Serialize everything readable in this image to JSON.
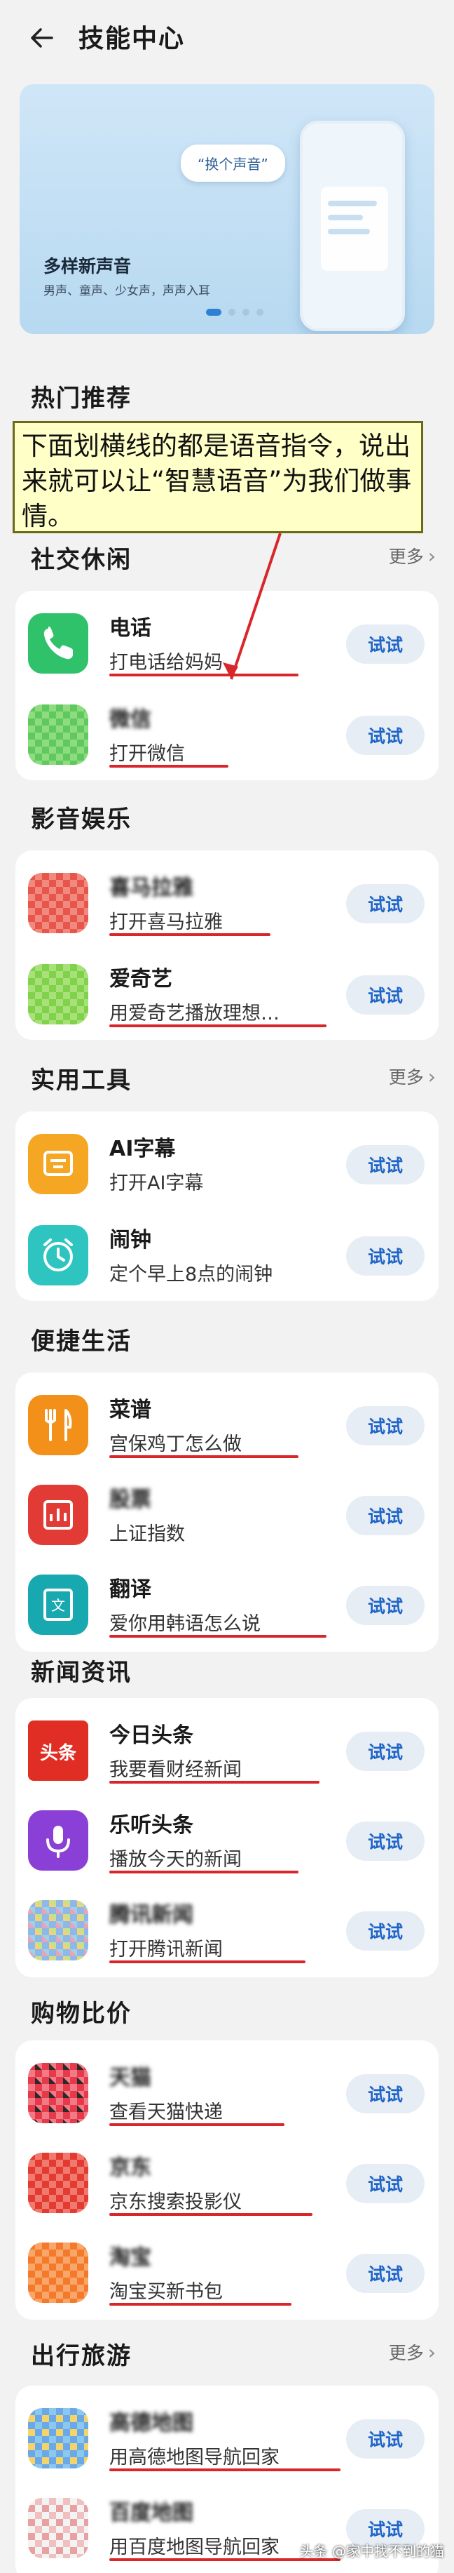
{
  "header": {
    "title": "技能中心"
  },
  "banner": {
    "title": "多样新声音",
    "subtitle": "男声、童声、少女声，声声入耳",
    "bubble": "“换个声音”"
  },
  "sections": {
    "hot": {
      "title": "热门推荐"
    },
    "social": {
      "title": "社交休闲",
      "more": "更多"
    },
    "media": {
      "title": "影音娱乐"
    },
    "tools": {
      "title": "实用工具",
      "more": "更多"
    },
    "life": {
      "title": "便捷生活"
    },
    "news": {
      "title": "新闻资讯"
    },
    "shopping": {
      "title": "购物比价"
    },
    "travel": {
      "title": "出行旅游",
      "more": "更多"
    }
  },
  "annotation": "下面划横线的都是语音指令，说出来就可以让“智慧语音”为我们做事情。",
  "rows": {
    "phone": {
      "title": "电话",
      "cmd": "打电话给妈妈",
      "try": "试试"
    },
    "social2": {
      "title": "微信",
      "cmd": "打开微信",
      "try": "试试"
    },
    "music": {
      "title": "喜马拉雅",
      "cmd": "打开喜马拉雅",
      "try": "试试"
    },
    "iqiyi": {
      "title": "爱奇艺",
      "cmd": "用爱奇艺播放理想…",
      "try": "试试"
    },
    "subtitle": {
      "title": "AI字幕",
      "cmd": "打开AI字幕",
      "try": "试试"
    },
    "alarm": {
      "title": "闹钟",
      "cmd": "定个早上8点的闹钟",
      "try": "试试"
    },
    "recipe": {
      "title": "菜谱",
      "cmd": "宫保鸡丁怎么做",
      "try": "试试"
    },
    "stock": {
      "title": "股票",
      "cmd": "上证指数",
      "try": "试试"
    },
    "translate": {
      "title": "翻译",
      "cmd": "爱你用韩语怎么说",
      "try": "试试"
    },
    "toutiao": {
      "title": "今日头条",
      "cmd": "我要看财经新闻",
      "try": "试试"
    },
    "listen": {
      "title": "乐听头条",
      "cmd": "播放今天的新闻",
      "try": "试试"
    },
    "tencent": {
      "title": "腾讯新闻",
      "cmd": "打开腾讯新闻",
      "try": "试试"
    },
    "tmall": {
      "title": "天猫",
      "cmd": "查看天猫快递",
      "try": "试试"
    },
    "jd": {
      "title": "京东",
      "cmd": "京东搜索投影仪",
      "try": "试试"
    },
    "taobao": {
      "title": "淘宝",
      "cmd": "淘宝买新书包",
      "try": "试试"
    },
    "map1": {
      "title": "高德地图",
      "cmd": "用高德地图导航回家",
      "try": "试试"
    },
    "map2": {
      "title": "百度地图",
      "cmd": "用百度地图导航回家",
      "try": "试试"
    }
  },
  "watermark": "头条 @家中找不到的猫",
  "colors": {
    "accent": "#1f64c7",
    "underline": "#d8262b",
    "annotation_bg": "#ffffc8"
  }
}
